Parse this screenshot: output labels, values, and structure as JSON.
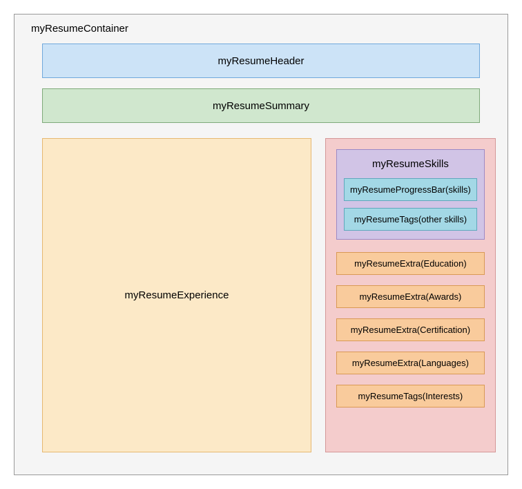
{
  "container": {
    "label": "myResumeContainer"
  },
  "header": {
    "label": "myResumeHeader"
  },
  "summary": {
    "label": "myResumeSummary"
  },
  "experience": {
    "label": "myResumeExperience"
  },
  "skills": {
    "label": "myResumeSkills",
    "progressBar": "myResumeProgressBar(skills)",
    "tags": "myResumeTags(other skills)"
  },
  "extras": {
    "education": "myResumeExtra(Education)",
    "awards": "myResumeExtra(Awards)",
    "certification": "myResumeExtra(Certification)",
    "languages": "myResumeExtra(Languages)",
    "interests": "myResumeTags(Interests)"
  }
}
